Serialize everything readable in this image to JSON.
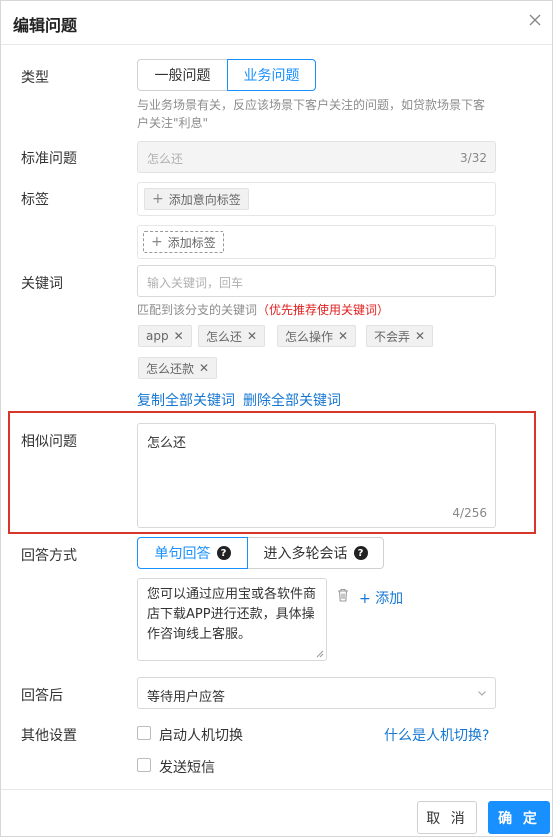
{
  "dialog": {
    "title": "编辑问题"
  },
  "type_field": {
    "label": "类型",
    "options": [
      "一般问题",
      "业务问题"
    ],
    "selected": "业务问题",
    "hint_line1": "与业务场景有关，反应该场景下客户关注的问题，如贷款场景下客",
    "hint_line2": "户关注\"利息\""
  },
  "standard_question": {
    "label": "标准问题",
    "value": "怎么还",
    "count": "3/32"
  },
  "tags": {
    "label": "标签",
    "add_intent_tag": "添加意向标签",
    "add_tag": "添加标签"
  },
  "keywords": {
    "label": "关键词",
    "placeholder": "输入关键词，回车",
    "hint_prefix": "匹配到该分支的关键词",
    "hint_emphasis": "（优先推荐使用关键词）",
    "items": [
      "app",
      "怎么还",
      "怎么操作",
      "不会弄",
      "怎么还款"
    ],
    "copy_all": "复制全部关键词",
    "delete_all": "删除全部关键词"
  },
  "similar_question": {
    "label": "相似问题",
    "value": "怎么还",
    "count": "4/256"
  },
  "answer_mode": {
    "label": "回答方式",
    "options": [
      "单句回答",
      "进入多轮会话"
    ],
    "selected": "单句回答",
    "answer_text": "您可以通过应用宝或各软件商店下载APP进行还款，具体操作咨询线上客服。",
    "add_label": "添加"
  },
  "after_answer": {
    "label": "回答后",
    "selected": "等待用户应答"
  },
  "other_settings": {
    "label": "其他设置",
    "enable_handoff": "启动人机切换",
    "send_sms": "发送短信",
    "help_link": "什么是人机切换?"
  },
  "footer": {
    "cancel": "取 消",
    "ok": "确 定"
  },
  "colors": {
    "accent": "#1890ff",
    "link": "#1677d2",
    "highlight": "#d9362a",
    "emphasis": "#e02020"
  }
}
